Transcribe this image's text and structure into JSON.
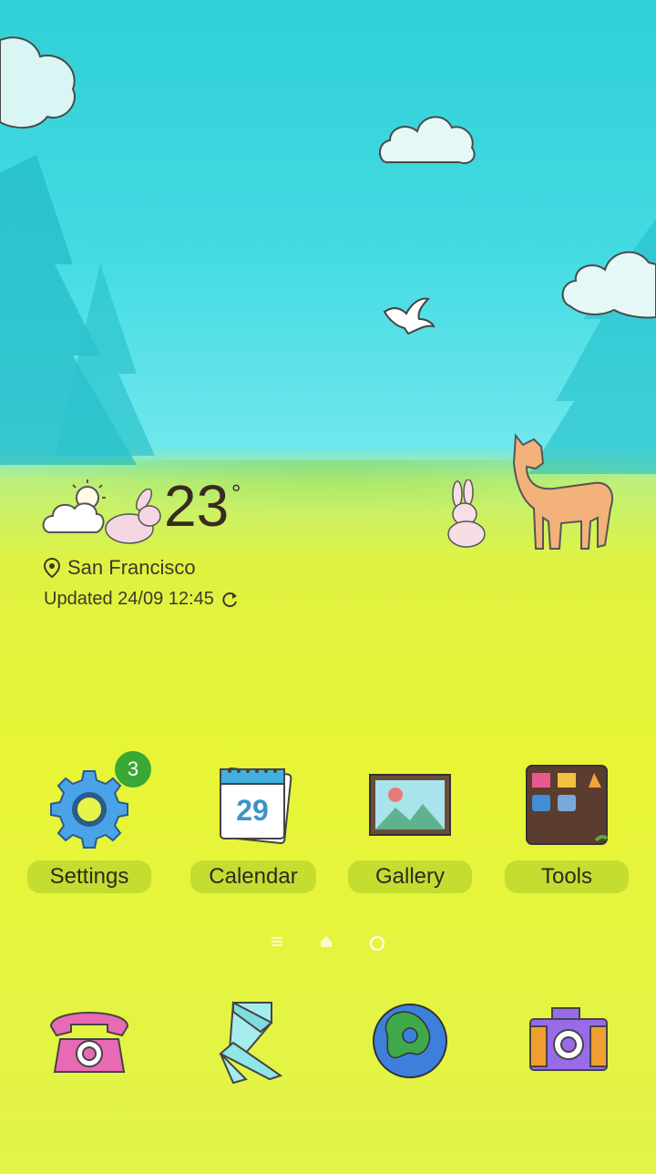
{
  "weather": {
    "temperature": "23",
    "degree_symbol": "°",
    "location": "San Francisco",
    "updated": "Updated 24/09 12:45"
  },
  "apps": [
    {
      "label": "Settings",
      "badge": "3"
    },
    {
      "label": "Calendar",
      "date": "29"
    },
    {
      "label": "Gallery"
    },
    {
      "label": "Tools"
    }
  ],
  "pager": {
    "current_page": 2,
    "pages": [
      "menu-icon",
      "home-icon",
      "dot-icon"
    ]
  },
  "dock": [
    {
      "icon": "phone-icon"
    },
    {
      "icon": "messages-icon"
    },
    {
      "icon": "browser-globe-icon"
    },
    {
      "icon": "camera-icon"
    }
  ],
  "colors": {
    "sky": "#2fd0d6",
    "meadow": "#e2f34a",
    "badge": "#39a834",
    "label_bg": "#aac828"
  }
}
